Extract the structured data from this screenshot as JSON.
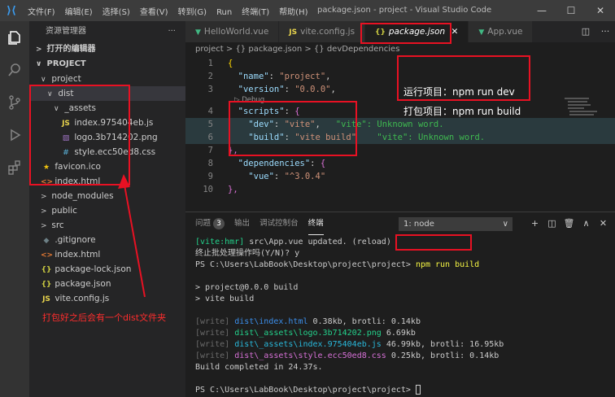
{
  "titlebar": {
    "menu": [
      "文件(F)",
      "编辑(E)",
      "选择(S)",
      "查看(V)",
      "转到(G)",
      "Run",
      "终端(T)",
      "帮助(H)"
    ],
    "title": "package.json - project - Visual Studio Code",
    "controls": [
      "—",
      "☐",
      "✕"
    ]
  },
  "sidebar": {
    "title": "资源管理器",
    "dots": "···",
    "open_editors": "打开的编辑器",
    "project_root": "PROJECT",
    "items": [
      {
        "label": "project",
        "chev": "∨"
      },
      {
        "label": "dist",
        "chev": "∨"
      },
      {
        "label": "_assets",
        "chev": "∨"
      },
      {
        "label": "index.975404eb.js",
        "icon": "JS"
      },
      {
        "label": "logo.3b714202.png",
        "icon": "▨"
      },
      {
        "label": "style.ecc50ed8.css",
        "icon": "#"
      },
      {
        "label": "favicon.ico",
        "icon": "★"
      },
      {
        "label": "index.html",
        "icon": "<>"
      },
      {
        "label": "node_modules",
        "chev": ">"
      },
      {
        "label": "public",
        "chev": ">"
      },
      {
        "label": "src",
        "chev": ">"
      },
      {
        "label": ".gitignore",
        "icon": "◆"
      },
      {
        "label": "index.html",
        "icon": "<>"
      },
      {
        "label": "package-lock.json",
        "icon": "{}"
      },
      {
        "label": "package.json",
        "icon": "{}"
      },
      {
        "label": "vite.config.js",
        "icon": "JS"
      }
    ]
  },
  "tabs": [
    {
      "label": "HelloWorld.vue",
      "icon": "▼"
    },
    {
      "label": "vite.config.js",
      "icon": "JS"
    },
    {
      "label": "package.json",
      "icon": "{}",
      "close": "✕"
    },
    {
      "label": "App.vue",
      "icon": "▼"
    }
  ],
  "tab_actions": [
    "◫",
    "···"
  ],
  "breadcrumb": "project > {} package.json > {} devDependencies",
  "code": {
    "lines": [
      "1",
      "2",
      "3",
      "4",
      "5",
      "6",
      "7",
      "8",
      "9",
      "10"
    ],
    "l1": "{",
    "l2_key": "\"name\"",
    "l2_val": "\"project\"",
    "l3_key": "\"version\"",
    "l3_val": "\"0.0.0\"",
    "codelens": "▷ Debug",
    "l4_key": "\"scripts\"",
    "l5_key": "\"dev\"",
    "l5_val": "\"vite\"",
    "l5_err": "\"vite\": Unknown word.",
    "l6_key": "\"build\"",
    "l6_val": "\"vite build\"",
    "l6_err": "\"vite\": Unknown word.",
    "l7": "},",
    "l8_key": "\"dependencies\"",
    "l9_key": "\"vue\"",
    "l9_val": "\"^3.0.4\"",
    "l10": "},"
  },
  "notes": {
    "run": "运行项目：npm run dev",
    "build": "打包项目：npm run build",
    "dist": "打包好之后会有一个dist文件夹"
  },
  "panel": {
    "tabs": [
      "问题",
      "输出",
      "调试控制台",
      "终端"
    ],
    "problems_count": "3",
    "terminal_select": "1: node",
    "actions": [
      "+",
      "◫",
      "🗑",
      "∧",
      "✕"
    ]
  },
  "terminal": {
    "hmr_tag": "[vite:hmr]",
    "hmr_text": " src\\App.vue updated. (reload)",
    "batch": "终止批处理操作吗(Y/N)? y",
    "prompt1": "PS C:\\Users\\LabBook\\Desktop\\project\\project>",
    "cmd": "npm run build",
    "out1": "> project@0.0.0 build",
    "out2": "> vite build",
    "w": "[write]",
    "f1": "dist\\index.html",
    "s1": " 0.38kb, brotli: 0.14kb",
    "f2": "dist\\_assets\\logo.3b714202.png",
    "s2": " 6.69kb",
    "f3": "dist\\_assets\\index.975404eb.js",
    "s3": " 46.99kb, brotli: 16.95kb",
    "f4": "dist\\_assets\\style.ecc50ed8.css",
    "s4": " 0.25kb, brotli: 0.14kb",
    "done": "Build completed in 24.37s.",
    "prompt2": "PS C:\\Users\\LabBook\\Desktop\\project\\project>"
  }
}
